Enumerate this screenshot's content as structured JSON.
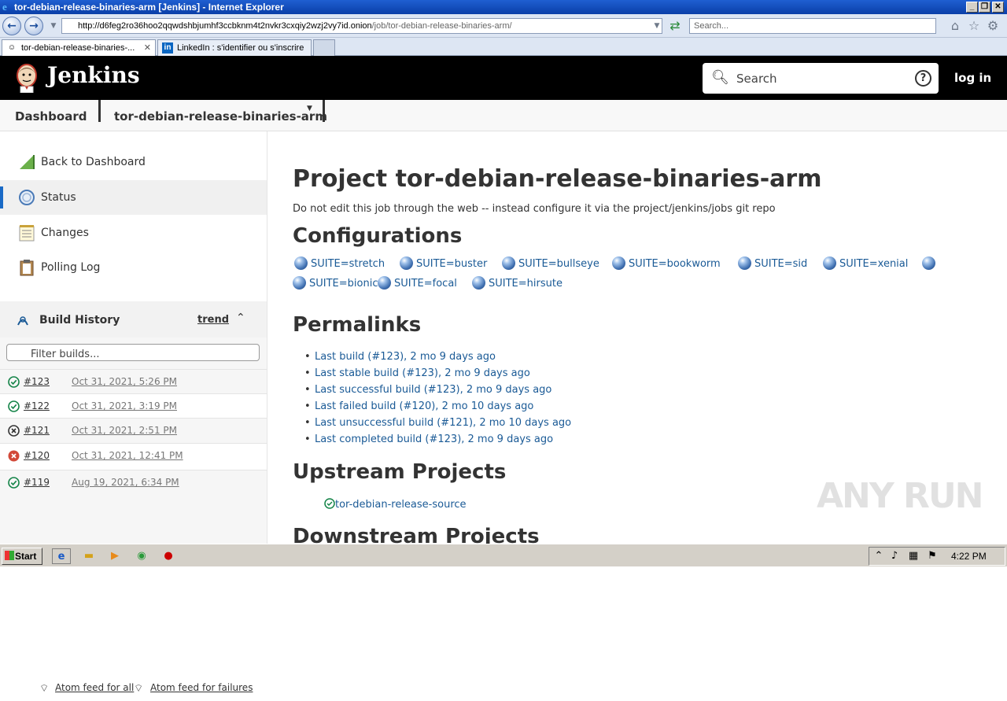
{
  "window": {
    "title": "tor-debian-release-binaries-arm [Jenkins] - Internet Explorer",
    "url_host": "http://d6feg2ro36hoo2qqwdshbjumhf3ccbknm4t2nvkr3cxqiy2wzj2vy7id.onion",
    "url_path": "/job/tor-debian-release-binaries-arm/",
    "search_placeholder": "Search..."
  },
  "ie_tabs": [
    {
      "label": "tor-debian-release-binaries-..."
    },
    {
      "label": "LinkedIn : s'identifier ou s'inscrire"
    }
  ],
  "header": {
    "brand": "Jenkins",
    "search_placeholder": "Search",
    "help": "?",
    "login": "log in"
  },
  "breadcrumb": {
    "dashboard": "Dashboard",
    "job": "tor-debian-release-binaries-arm"
  },
  "sidebar": {
    "items": [
      {
        "label": "Back to Dashboard",
        "icon": "up-arrow-icon"
      },
      {
        "label": "Status",
        "icon": "search-icon"
      },
      {
        "label": "Changes",
        "icon": "notepad-icon"
      },
      {
        "label": "Polling Log",
        "icon": "clipboard-icon"
      }
    ]
  },
  "build_history": {
    "title": "Build History",
    "trend": "trend",
    "filter_placeholder": "Filter builds...",
    "builds": [
      {
        "num": "#123",
        "date": "Oct 31, 2021, 5:26 PM",
        "status": "success"
      },
      {
        "num": "#122",
        "date": "Oct 31, 2021, 3:19 PM",
        "status": "success"
      },
      {
        "num": "#121",
        "date": "Oct 31, 2021, 2:51 PM",
        "status": "aborted"
      },
      {
        "num": "#120",
        "date": "Oct 31, 2021, 12:41 PM",
        "status": "failed"
      },
      {
        "num": "#119",
        "date": "Aug 19, 2021, 6:34 PM",
        "status": "success"
      }
    ],
    "feed_all": "Atom feed for all",
    "feed_failures": "Atom feed for failures"
  },
  "main": {
    "title": "Project tor-debian-release-binaries-arm",
    "description": "Do not edit this job through the web -- instead configure it via the project/jenkins/jobs git repo",
    "configurations_heading": "Configurations",
    "configurations": [
      "SUITE=stretch",
      "SUITE=buster",
      "SUITE=bullseye",
      "SUITE=bookworm",
      "SUITE=sid",
      "SUITE=xenial",
      "SUITE=bionic",
      "SUITE=focal",
      "SUITE=hirsute"
    ],
    "permalinks_heading": "Permalinks",
    "permalinks": [
      "Last build (#123), 2 mo 9 days ago",
      "Last stable build (#123), 2 mo 9 days ago",
      "Last successful build (#123), 2 mo 9 days ago",
      "Last failed build (#120), 2 mo 10 days ago",
      "Last unsuccessful build (#121), 2 mo 10 days ago",
      "Last completed build (#123), 2 mo 9 days ago"
    ],
    "upstream_heading": "Upstream Projects",
    "upstream": "tor-debian-release-source",
    "downstream_heading": "Downstream Projects"
  },
  "watermark": "ANY RUN",
  "taskbar": {
    "start": "Start",
    "clock": "4:22 PM"
  },
  "colors": {
    "link": "#1a5a96",
    "success": "#138347",
    "failed": "#d24939",
    "header_bg": "#000000"
  }
}
